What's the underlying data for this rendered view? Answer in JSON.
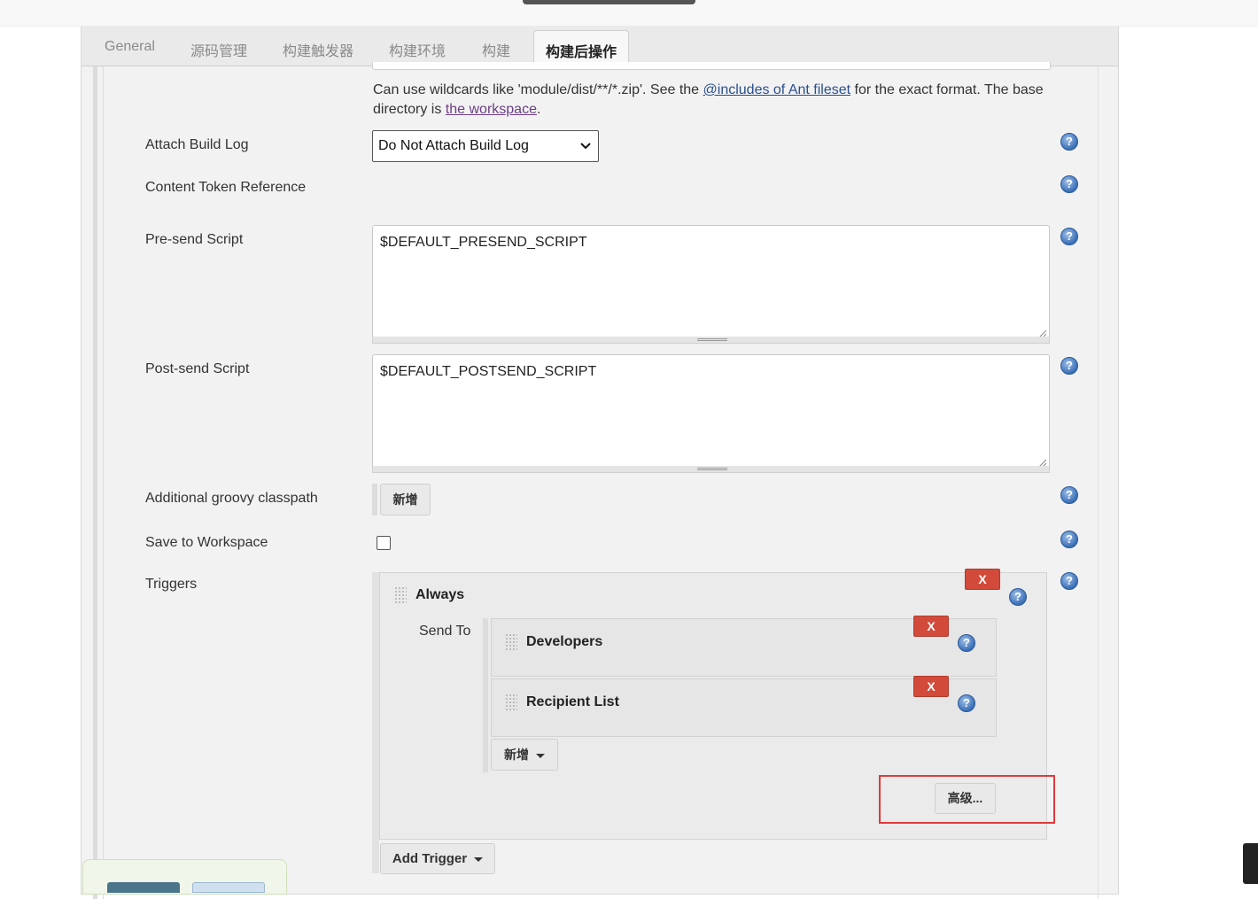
{
  "tabs": [
    {
      "label": "General",
      "active": false
    },
    {
      "label": "源码管理",
      "active": false
    },
    {
      "label": "构建触发器",
      "active": false
    },
    {
      "label": "构建环境",
      "active": false
    },
    {
      "label": "构建",
      "active": false
    },
    {
      "label": "构建后操作",
      "active": true
    }
  ],
  "attachments_help": {
    "part1": "Can use wildcards like 'module/dist/**/*.zip'. See the ",
    "link1": "@includes of Ant fileset",
    "part2": " for the exact format. The base directory is ",
    "link2": "the workspace",
    "part3": "."
  },
  "fields": {
    "attach_build_log": {
      "label": "Attach Build Log",
      "value": "Do Not Attach Build Log"
    },
    "content_token_reference": {
      "label": "Content Token Reference"
    },
    "presend_script": {
      "label": "Pre-send Script",
      "value": "$DEFAULT_PRESEND_SCRIPT"
    },
    "postsend_script": {
      "label": "Post-send Script",
      "value": "$DEFAULT_POSTSEND_SCRIPT"
    },
    "groovy_classpath": {
      "label": "Additional groovy classpath",
      "add_label": "新增"
    },
    "save_to_workspace": {
      "label": "Save to Workspace",
      "checked": false
    },
    "triggers": {
      "label": "Triggers"
    }
  },
  "trigger": {
    "title": "Always",
    "delete_label": "X",
    "send_to_label": "Send To",
    "recipients": [
      {
        "title": "Developers",
        "delete_label": "X"
      },
      {
        "title": "Recipient List",
        "delete_label": "X"
      }
    ],
    "add_label": "新增",
    "advanced_label": "高级..."
  },
  "add_trigger_label": "Add Trigger",
  "colors": {
    "delete": "#d24a3a",
    "highlight": "#e03a3a",
    "help": "#3a6fb6",
    "link": "#2a4f8f"
  }
}
